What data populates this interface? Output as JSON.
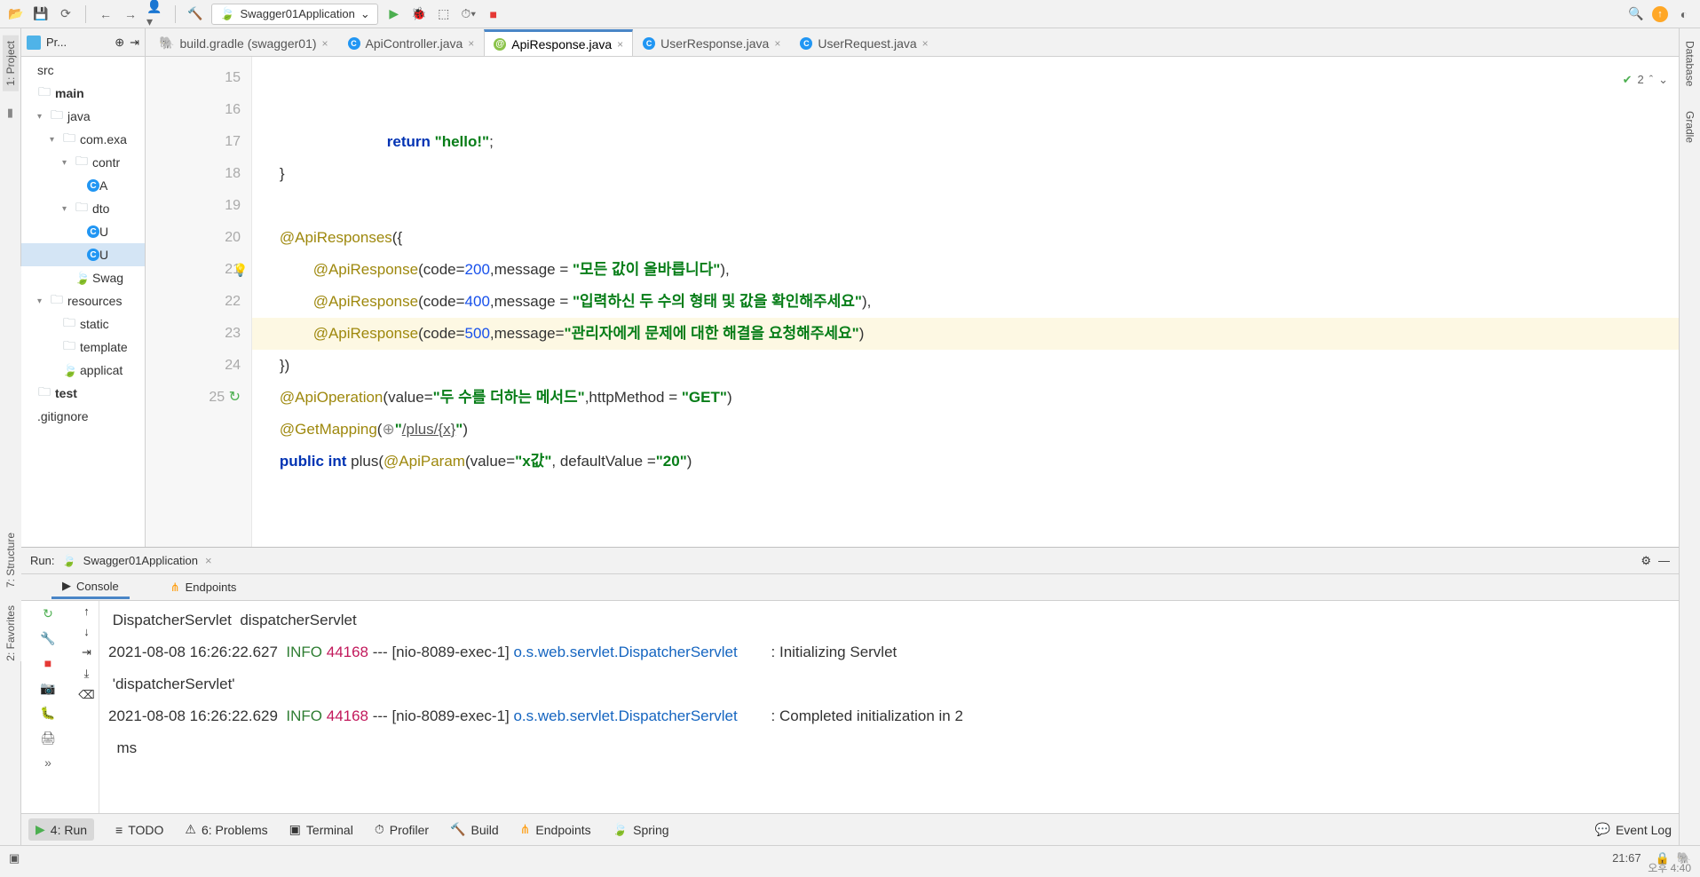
{
  "toolbar": {
    "run_config_label": "Swagger01Application"
  },
  "left_rail": {
    "project": "1: Project"
  },
  "right_rail": {
    "database": "Database",
    "gradle": "Gradle"
  },
  "far_left_rail": {
    "structure": "7: Structure",
    "favorites": "2: Favorites"
  },
  "project_tree": {
    "header": "Pr...",
    "nodes": [
      {
        "indent": 0,
        "arrow": "",
        "icon": "",
        "label": "src",
        "cls": ""
      },
      {
        "indent": 0,
        "arrow": "",
        "icon": "folder",
        "label": "main",
        "bold": true
      },
      {
        "indent": 1,
        "arrow": "▾",
        "icon": "folder",
        "label": "java"
      },
      {
        "indent": 2,
        "arrow": "▾",
        "icon": "folder",
        "label": "com.exa"
      },
      {
        "indent": 3,
        "arrow": "▾",
        "icon": "folder",
        "label": "contr"
      },
      {
        "indent": 4,
        "arrow": "",
        "icon": "class",
        "label": "A"
      },
      {
        "indent": 3,
        "arrow": "▾",
        "icon": "folder",
        "label": "dto"
      },
      {
        "indent": 4,
        "arrow": "",
        "icon": "class",
        "label": "U"
      },
      {
        "indent": 4,
        "arrow": "",
        "icon": "class",
        "label": "U",
        "sel": true
      },
      {
        "indent": 3,
        "arrow": "",
        "icon": "leaf",
        "label": "Swag"
      },
      {
        "indent": 1,
        "arrow": "▾",
        "icon": "folder",
        "label": "resources"
      },
      {
        "indent": 2,
        "arrow": "",
        "icon": "folder",
        "label": "static"
      },
      {
        "indent": 2,
        "arrow": "",
        "icon": "folder",
        "label": "template"
      },
      {
        "indent": 2,
        "arrow": "",
        "icon": "leaf",
        "label": "applicat"
      },
      {
        "indent": 0,
        "arrow": "",
        "icon": "folder",
        "label": "test",
        "bold": true
      },
      {
        "indent": 0,
        "arrow": "",
        "icon": "",
        "label": ".gitignore"
      }
    ]
  },
  "editor_tabs": [
    {
      "icon": "gradle",
      "label": "build.gradle (swagger01)",
      "active": false
    },
    {
      "icon": "class",
      "label": "ApiController.java",
      "active": false
    },
    {
      "icon": "anno",
      "label": "ApiResponse.java",
      "active": true
    },
    {
      "icon": "class",
      "label": "UserResponse.java",
      "active": false
    },
    {
      "icon": "class",
      "label": "UserRequest.java",
      "active": false
    }
  ],
  "editor": {
    "status_count": "2",
    "lines": [
      {
        "n": "15",
        "html": "        <span class='kw'>return</span> <span class='str'>\"hello!\"</span>;"
      },
      {
        "n": "16",
        "html": "    }"
      },
      {
        "n": "17",
        "html": ""
      },
      {
        "n": "18",
        "html": "    <span class='anno'>@ApiResponses</span>({"
      },
      {
        "n": "19",
        "html": "            <span class='anno'>@ApiResponse</span>(code=<span class='num'>200</span>,message = <span class='str'>\"모든 값이 올바릅니다\"</span>),"
      },
      {
        "n": "20",
        "html": "            <span class='anno'>@ApiResponse</span>(code=<span class='num'>400</span>,message = <span class='str'>\"입력하신 두 수의 형태 및 값을 확인해주세요\"</span>),"
      },
      {
        "n": "21",
        "hl": true,
        "bulb": true,
        "html": "            <span class='anno'>@ApiResponse</span>(code=<span class='num'>500</span>,message=<span class='str'>\"관리자에게 문제에 대한 해결을 요청해주세요\"</span>)"
      },
      {
        "n": "22",
        "html": "    })"
      },
      {
        "n": "23",
        "html": "    <span class='anno'>@ApiOperation</span>(value=<span class='str'>\"두 수를 더하는 메서드\"</span>,httpMethod = <span class='str'>\"GET\"</span>)"
      },
      {
        "n": "24",
        "html": "    <span class='anno'>@GetMapping</span>(<span class='com'>⊕</span><span class='str'>\"</span><span class='lnk'>/plus/{x}</span><span class='str'>\"</span>)"
      },
      {
        "n": "25",
        "icon": true,
        "html": "    <span class='kw'>public int</span> plus(<span class='anno'>@ApiParam</span>(value=<span class='str'>\"x값\"</span>, defaultValue =<span class='str'>\"20\"</span>)"
      }
    ]
  },
  "run": {
    "label": "Run:",
    "config": "Swagger01Application",
    "tabs": {
      "console": "Console",
      "endpoints": "Endpoints"
    },
    "lines": [
      " DispatcherServlet  dispatcherServlet",
      "2021-08-08 16:26:22.627  <span class='info'>INFO</span> <span class='pid'>44168</span> --- [nio-8089-exec-1] <span class='cls'>o.s.web.servlet.DispatcherServlet</span>        : Initializing Servlet",
      " 'dispatcherServlet'",
      "2021-08-08 16:26:22.629  <span class='info'>INFO</span> <span class='pid'>44168</span> --- [nio-8089-exec-1] <span class='cls'>o.s.web.servlet.DispatcherServlet</span>        : Completed initialization in 2",
      "  ms"
    ]
  },
  "bottom_tabs": {
    "run": "4: Run",
    "todo": "TODO",
    "problems": "6: Problems",
    "terminal": "Terminal",
    "profiler": "Profiler",
    "build": "Build",
    "endpoints": "Endpoints",
    "spring": "Spring",
    "eventlog": "Event Log"
  },
  "status": {
    "pos": "21:67",
    "time": "오후 4:40"
  }
}
